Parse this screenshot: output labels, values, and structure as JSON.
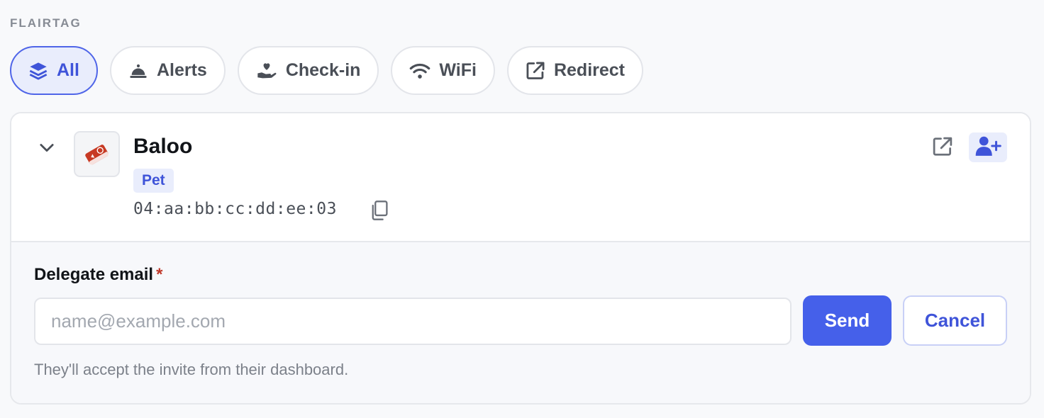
{
  "section": {
    "label": "FLAIRTAG"
  },
  "filters": [
    {
      "label": "All",
      "icon": "layers-icon",
      "active": true
    },
    {
      "label": "Alerts",
      "icon": "bell-icon",
      "active": false
    },
    {
      "label": "Check-in",
      "icon": "hand-heart-icon",
      "active": false
    },
    {
      "label": "WiFi",
      "icon": "wifi-icon",
      "active": false
    },
    {
      "label": "Redirect",
      "icon": "external-link-icon",
      "active": false
    }
  ],
  "tag_card": {
    "name": "Baloo",
    "category": "Pet",
    "mac": "04:aa:bb:cc:dd:ee:03",
    "thumbnail_icon": "tag-thumbnail-icon"
  },
  "delegate_form": {
    "label": "Delegate email",
    "required_mark": "*",
    "placeholder": "name@example.com",
    "value": "",
    "send_label": "Send",
    "cancel_label": "Cancel",
    "hint": "They'll accept the invite from their dashboard."
  },
  "colors": {
    "accent": "#4560ea",
    "accent_soft": "#e9edfc",
    "required": "#c0392b"
  }
}
